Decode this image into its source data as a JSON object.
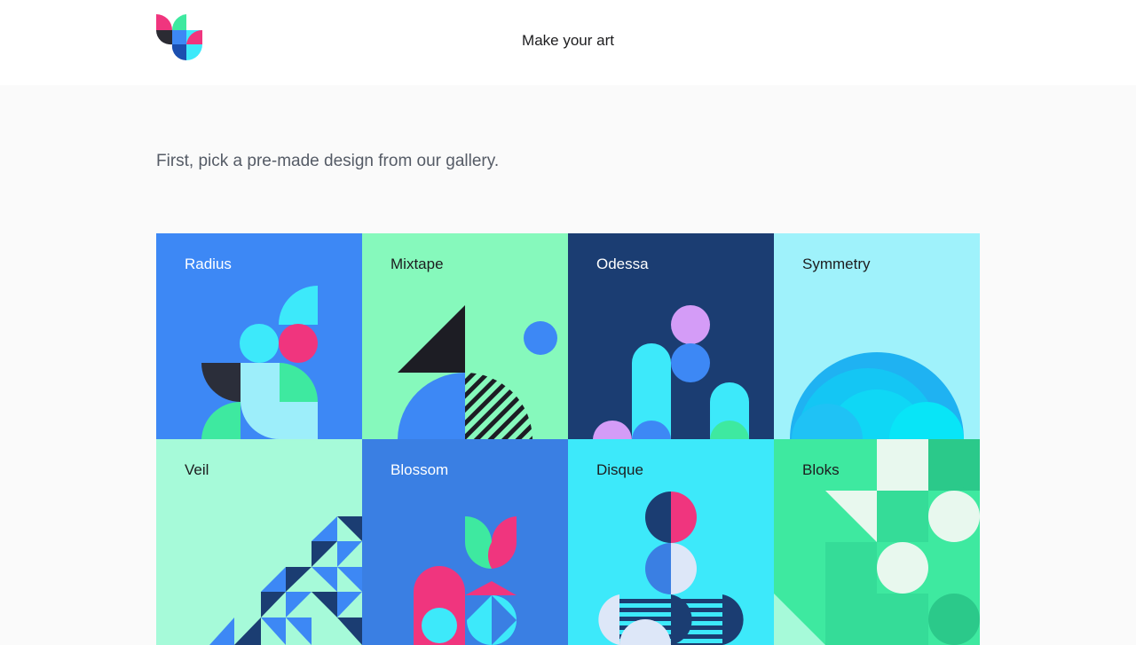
{
  "header": {
    "title": "Make your art",
    "logo_icon": "flower-logo-icon"
  },
  "intro": {
    "text": "First, pick a pre-made design from our gallery."
  },
  "gallery": {
    "items": [
      {
        "label": "Radius",
        "bg": "#3d88f5"
      },
      {
        "label": "Mixtape",
        "bg": "#86f9bc"
      },
      {
        "label": "Odessa",
        "bg": "#1b3d72"
      },
      {
        "label": "Symmetry",
        "bg": "#9ff2fb"
      },
      {
        "label": "Veil",
        "bg": "#a6fad9"
      },
      {
        "label": "Blossom",
        "bg": "#3a7fe3"
      },
      {
        "label": "Disque",
        "bg": "#3de9fa"
      },
      {
        "label": "Bloks",
        "bg": "#3ee9a0"
      }
    ]
  }
}
